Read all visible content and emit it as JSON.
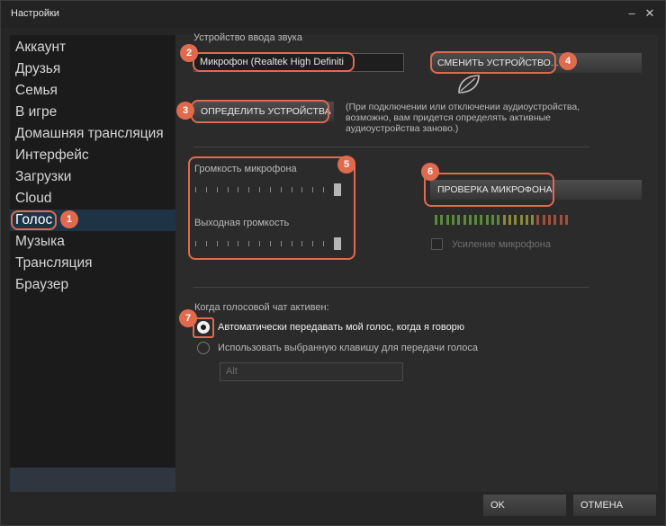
{
  "window": {
    "title": "Настройки"
  },
  "sidebar": {
    "items": [
      {
        "label": "Аккаунт"
      },
      {
        "label": "Друзья"
      },
      {
        "label": "Семья"
      },
      {
        "label": "В игре"
      },
      {
        "label": "Домашняя трансляция"
      },
      {
        "label": "Интерфейс"
      },
      {
        "label": "Загрузки"
      },
      {
        "label": "Cloud"
      },
      {
        "label": "Голос",
        "active": true
      },
      {
        "label": "Музыка"
      },
      {
        "label": "Трансляция"
      },
      {
        "label": "Браузер"
      }
    ]
  },
  "voice": {
    "input_device_label": "Устройство ввода звука",
    "input_device_value": "Микрофон (Realtek High Definiti",
    "change_device_button": "СМЕНИТЬ УСТРОЙСТВО...",
    "detect_devices_button": "ОПРЕДЕЛИТЬ УСТРОЙСТВА",
    "detect_note_line1": "(При подключении или отключении аудиоустройства,",
    "detect_note_line2": "возможно, вам придется определять активные",
    "detect_note_line3": "аудиоустройства заново.)",
    "mic_volume_label": "Громкость микрофона",
    "mic_volume_level": 1.0,
    "output_volume_label": "Выходная громкость",
    "output_volume_level": 1.0,
    "test_mic_button": "ПРОВЕРКА МИКРОФОНА",
    "mic_boost_label": "Усиление микрофона",
    "mic_boost_checked": false,
    "voice_active_label": "Когда голосовой чат активен:",
    "option_auto": "Автоматически передавать мой голос, когда я говорю",
    "option_push_to_talk": "Использовать выбранную клавишу для передачи голоса",
    "push_to_talk_key": "Alt",
    "selected_option": "auto"
  },
  "level_meter": {
    "green": "#5a8a3a",
    "yellow": "#8a8a3a",
    "red": "#a0503a"
  },
  "annotations": {
    "color": "#e06a4e",
    "badges": [
      "1",
      "2",
      "3",
      "4",
      "5",
      "6",
      "7"
    ]
  },
  "footer": {
    "ok_button": "OK",
    "cancel_button": "ОТМЕНА"
  }
}
